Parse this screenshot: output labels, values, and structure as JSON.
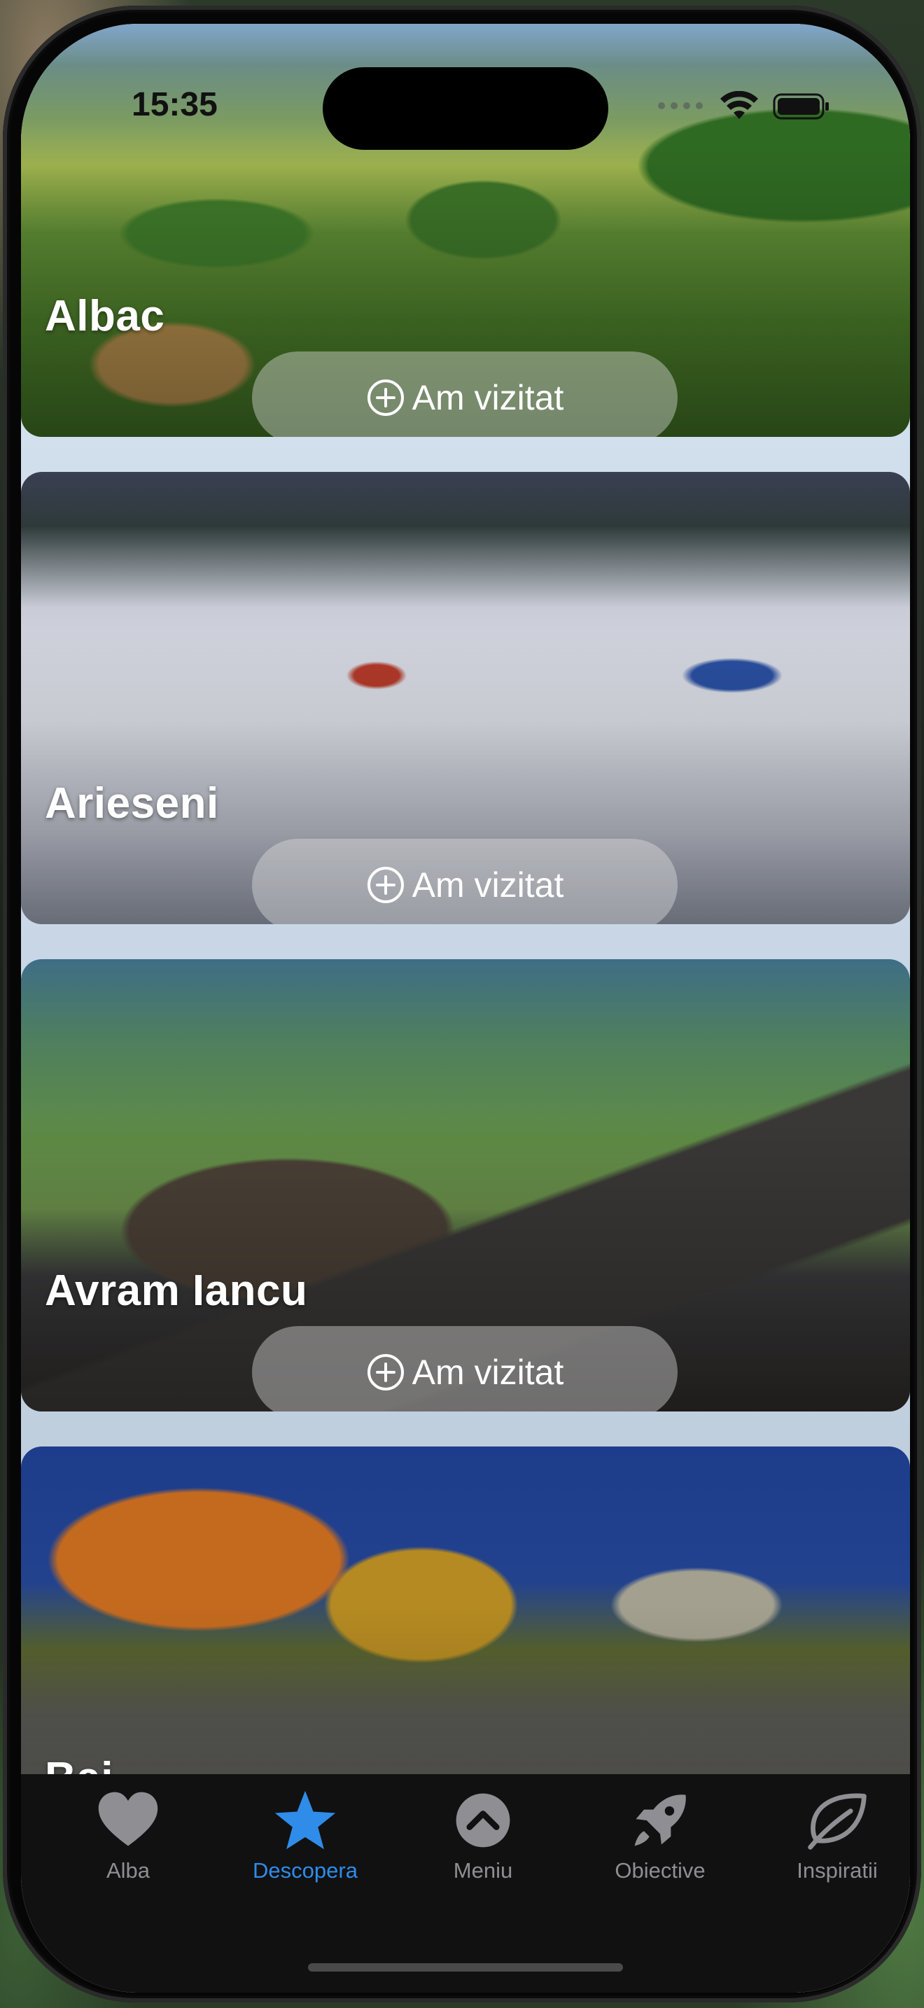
{
  "status_bar": {
    "time": "15:35"
  },
  "places": [
    {
      "name": "Albac",
      "button_label": "Am vizitat"
    },
    {
      "name": "Arieseni",
      "button_label": "Am vizitat"
    },
    {
      "name": "Avram Iancu",
      "button_label": "Am vizitat"
    },
    {
      "name": "Bai...",
      "button_label": ""
    }
  ],
  "tab_bar": {
    "active_color": "#2f8ce9",
    "inactive_color": "#8e8e93",
    "tabs": [
      {
        "label": "Alba",
        "icon": "heart-icon"
      },
      {
        "label": "Descopera",
        "icon": "star-icon",
        "active": true
      },
      {
        "label": "Meniu",
        "icon": "chevron-up-circle-icon"
      },
      {
        "label": "Obiective",
        "icon": "rocket-icon"
      },
      {
        "label": "Inspiratii",
        "icon": "leaf-icon"
      }
    ]
  }
}
